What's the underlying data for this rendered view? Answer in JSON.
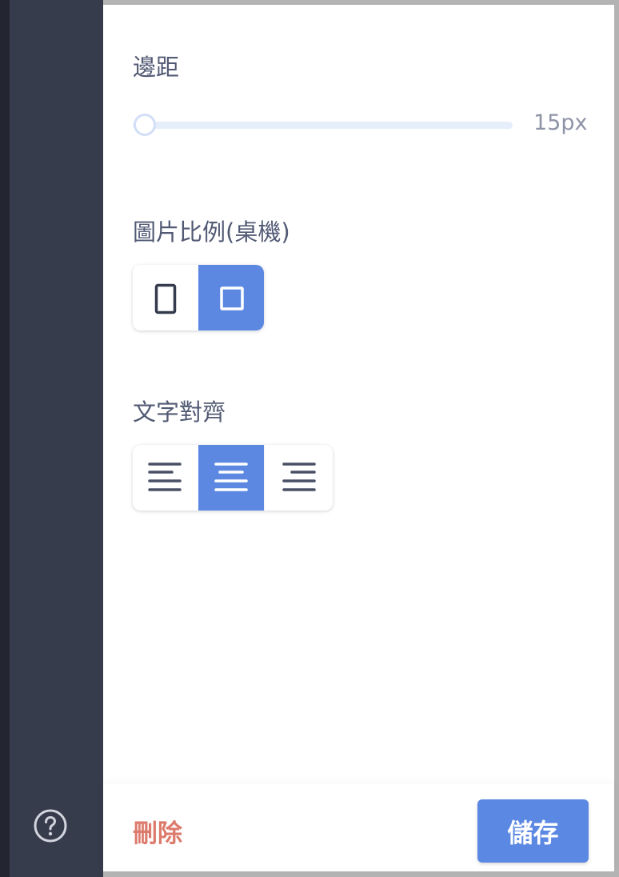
{
  "sidebar": {
    "help_icon": "question-circle-icon"
  },
  "padding": {
    "label": "邊距",
    "value": 15,
    "min": 15,
    "value_text": "15px"
  },
  "image_ratio": {
    "label": "圖片比例(桌機)",
    "options": [
      {
        "icon": "portrait-rect-icon",
        "selected": false
      },
      {
        "icon": "square-icon",
        "selected": true
      }
    ]
  },
  "text_align": {
    "label": "文字對齊",
    "options": [
      {
        "icon": "align-left-icon",
        "selected": false
      },
      {
        "icon": "align-center-icon",
        "selected": true
      },
      {
        "icon": "align-right-icon",
        "selected": false
      }
    ]
  },
  "footer": {
    "delete_label": "刪除",
    "save_label": "儲存"
  },
  "colors": {
    "accent": "#5b88e2",
    "danger": "#dc7a6c",
    "sidebar": "#373c4c"
  }
}
